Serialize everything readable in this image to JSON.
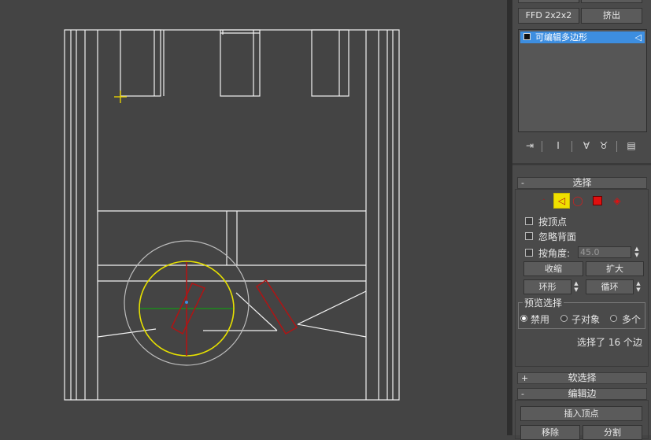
{
  "viewport": {
    "name": "perspective-viewport"
  },
  "modifier_panel": {
    "top_buttons": [
      {
        "label": "FFD 2x2x2"
      },
      {
        "label": "挤出"
      }
    ],
    "stack_item": {
      "label": "可编辑多边形"
    },
    "stack_toolbar_icons": [
      "pin-stack-icon",
      "show-end-result-icon",
      "make-unique-icon",
      "remove-modifier-icon",
      "configure-modifier-sets-icon"
    ]
  },
  "selection": {
    "title": "选择",
    "subobject_icons": [
      "vertex-icon",
      "edge-icon",
      "border-icon",
      "polygon-icon",
      "element-icon"
    ],
    "by_vertex": "按顶点",
    "ignore_backfacing": "忽略背面",
    "by_angle": "按角度:",
    "angle_value": "45.0",
    "shrink": "收缩",
    "grow": "扩大",
    "ring": "环形",
    "loop": "循环",
    "preview_title": "预览选择",
    "preview_options": [
      "禁用",
      "子对象",
      "多个"
    ],
    "status": "选择了 16 个边"
  },
  "soft_selection": {
    "title": "软选择"
  },
  "edit_edges": {
    "title": "编辑边",
    "insert_vertex": "插入顶点",
    "remove": "移除",
    "split": "分割"
  },
  "colors": {
    "accent_blue": "#3d8ee0",
    "active_yellow": "#f0e000",
    "edge_red": "#b01414"
  }
}
